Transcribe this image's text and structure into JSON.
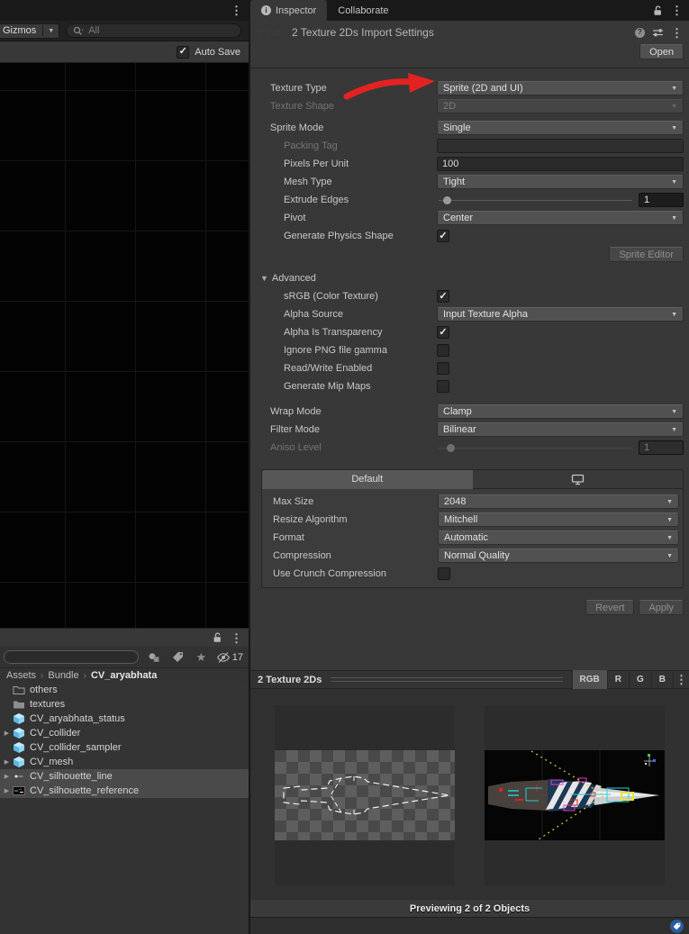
{
  "colors": {
    "arrow_red": "#e32222",
    "prefab_blue": "#7fd1f2",
    "bundle_tag_blue": "#2b5c9f",
    "selection_gray": "#4a4a4a"
  },
  "scene_panel": {
    "gizmos_label": "Gizmos",
    "search_placeholder": "All",
    "auto_save_label": "Auto Save"
  },
  "project_panel": {
    "hidden_count": "17",
    "breadcrumb": [
      "Assets",
      "Bundle",
      "CV_aryabhata"
    ],
    "items": [
      {
        "name": "others",
        "icon": "folder-outline-icon",
        "selected": false,
        "expandable": false
      },
      {
        "name": "textures",
        "icon": "folder-icon",
        "selected": false,
        "expandable": false
      },
      {
        "name": "CV_aryabhata_status",
        "icon": "prefab-icon",
        "selected": false,
        "expandable": false
      },
      {
        "name": "CV_collider",
        "icon": "prefab-icon",
        "selected": false,
        "expandable": true
      },
      {
        "name": "CV_collider_sampler",
        "icon": "prefab-icon",
        "selected": false,
        "expandable": false
      },
      {
        "name": "CV_mesh",
        "icon": "prefab-icon",
        "selected": false,
        "expandable": true
      },
      {
        "name": "CV_silhouette_line",
        "icon": "sprite-dot-icon",
        "selected": true,
        "expandable": true
      },
      {
        "name": "CV_silhouette_reference",
        "icon": "texture-thumb-icon",
        "selected": true,
        "expandable": true
      }
    ]
  },
  "inspector": {
    "tabs": [
      {
        "label": "Inspector",
        "active": true
      },
      {
        "label": "Collaborate",
        "active": false
      }
    ],
    "title": "2 Texture 2Ds Import Settings",
    "open_label": "Open",
    "rows": [
      {
        "label": "Texture Type",
        "type": "dropdown",
        "value": "Sprite (2D and UI)"
      },
      {
        "label": "Texture Shape",
        "type": "dropdown",
        "value": "2D",
        "disabled": true
      },
      {
        "label": "Sprite Mode",
        "type": "dropdown",
        "value": "Single",
        "gap": 8
      },
      {
        "label": "Packing Tag",
        "type": "text",
        "value": "",
        "indent": 1,
        "disabled": true
      },
      {
        "label": "Pixels Per Unit",
        "type": "text",
        "value": "100",
        "indent": 1
      },
      {
        "label": "Mesh Type",
        "type": "dropdown",
        "value": "Tight",
        "indent": 1
      },
      {
        "label": "Extrude Edges",
        "type": "slider",
        "value": "1",
        "indent": 1,
        "pos": 3
      },
      {
        "label": "Pivot",
        "type": "dropdown",
        "value": "Center",
        "indent": 1
      },
      {
        "label": "Generate Physics Shape",
        "type": "checkbox",
        "checked": true,
        "indent": 1
      },
      {
        "type": "button-row",
        "button": "Sprite Editor",
        "disabled": true,
        "gap": 4
      },
      {
        "label": "Advanced",
        "type": "foldout",
        "gap": 9,
        "expanded": true
      },
      {
        "label": "sRGB (Color Texture)",
        "type": "checkbox",
        "checked": true,
        "indent": 1
      },
      {
        "label": "Alpha Source",
        "type": "dropdown",
        "value": "Input Texture Alpha",
        "indent": 1
      },
      {
        "label": "Alpha Is Transparency",
        "type": "checkbox",
        "checked": true,
        "indent": 1
      },
      {
        "label": "Ignore PNG file gamma",
        "type": "checkbox",
        "checked": false,
        "indent": 1
      },
      {
        "label": "Read/Write Enabled",
        "type": "checkbox",
        "checked": false,
        "indent": 1
      },
      {
        "label": "Generate Mip Maps",
        "type": "checkbox",
        "checked": false,
        "indent": 1
      },
      {
        "label": "Wrap Mode",
        "type": "dropdown",
        "value": "Clamp",
        "gap": 12
      },
      {
        "label": "Filter Mode",
        "type": "dropdown",
        "value": "Bilinear"
      },
      {
        "label": "Aniso Level",
        "type": "slider",
        "value": "1",
        "disabled": true,
        "pos": 5
      }
    ],
    "platform": {
      "tabs": [
        {
          "label": "Default",
          "active": true
        },
        {
          "icon": "monitor-icon",
          "active": false
        }
      ],
      "rows": [
        {
          "label": "Max Size",
          "type": "dropdown",
          "value": "2048"
        },
        {
          "label": "Resize Algorithm",
          "type": "dropdown",
          "value": "Mitchell"
        },
        {
          "label": "Format",
          "type": "dropdown",
          "value": "Automatic"
        },
        {
          "label": "Compression",
          "type": "dropdown",
          "value": "Normal Quality"
        },
        {
          "label": "Use Crunch Compression",
          "type": "checkbox",
          "checked": false
        }
      ]
    },
    "revert_label": "Revert",
    "apply_label": "Apply"
  },
  "preview": {
    "header": "2 Texture 2Ds",
    "channels": [
      {
        "label": "RGB",
        "active": true
      },
      {
        "label": "R",
        "active": false
      },
      {
        "label": "G",
        "active": false
      },
      {
        "label": "B",
        "active": false
      }
    ],
    "footer": "Previewing 2 of 2 Objects",
    "items": [
      {
        "name": "silhouette-line-texture"
      },
      {
        "name": "silhouette-reference-texture"
      }
    ]
  }
}
